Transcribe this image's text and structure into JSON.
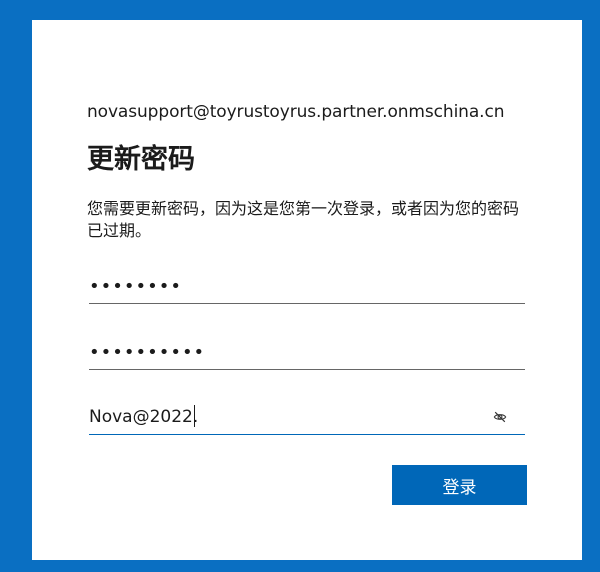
{
  "colors": {
    "page_background": "#0a6fc2",
    "card_background": "#ffffff",
    "primary_button": "#0067b8",
    "text": "#1b1b1b"
  },
  "account": {
    "email": "novasupport@toyrustoyrus.partner.onmschina.cn"
  },
  "page": {
    "title": "更新密码",
    "description": "您需要更新密码，因为这是您第一次登录，或者因为您的密码已过期。"
  },
  "fields": {
    "current_password": {
      "masked_value": "••••••••"
    },
    "new_password": {
      "masked_value": "••••••••••"
    },
    "confirm_password": {
      "value": "Nova@2022.",
      "reveal_icon": "eye-slash-icon"
    }
  },
  "actions": {
    "sign_in_label": "登录"
  }
}
